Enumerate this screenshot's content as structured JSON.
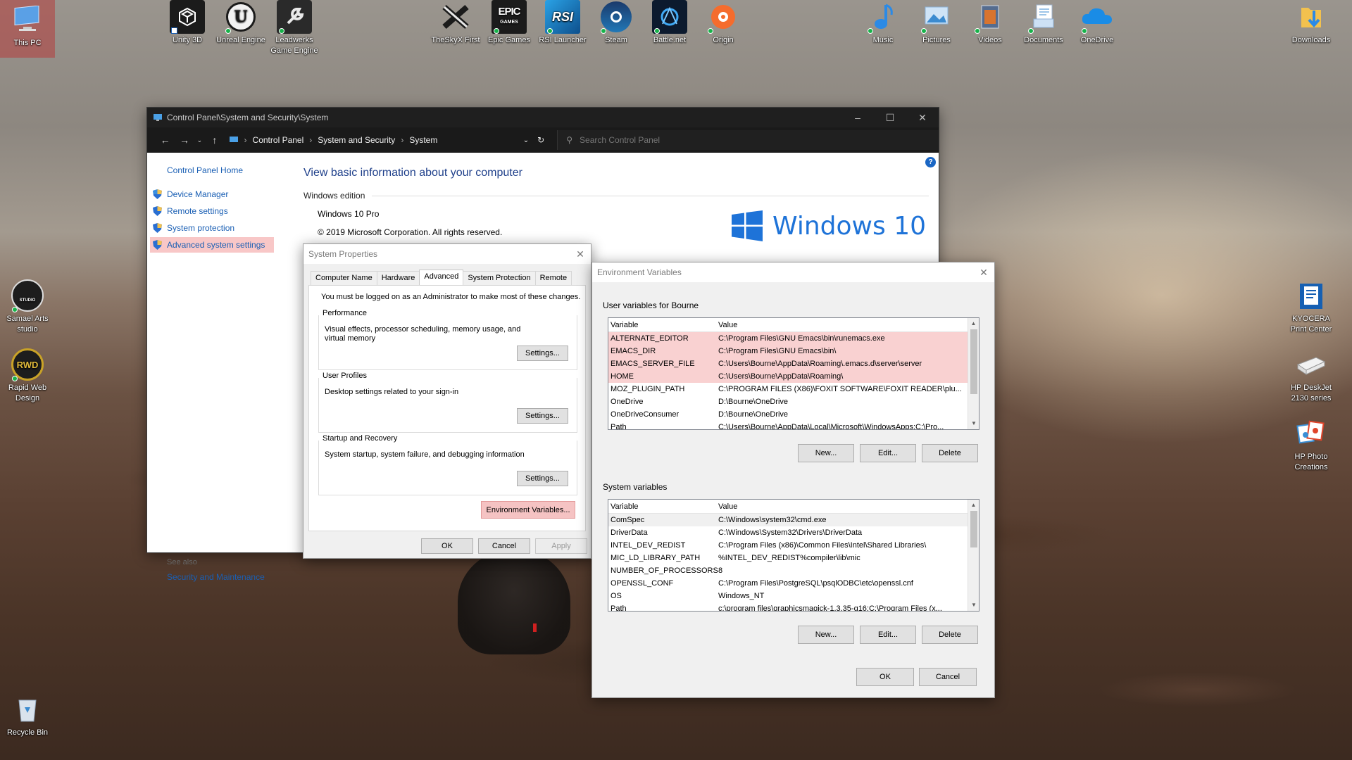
{
  "desktop": {
    "icons": [
      {
        "label": "This PC"
      },
      {
        "label": "Unity 3D"
      },
      {
        "label": "Unreal Engine"
      },
      {
        "label": "Leadwerks Game Engine"
      },
      {
        "label": "TheSkyX First"
      },
      {
        "label": "Epic Games"
      },
      {
        "label": "RSI Launcher"
      },
      {
        "label": "Steam"
      },
      {
        "label": "Battle.net"
      },
      {
        "label": "Origin"
      },
      {
        "label": "Music"
      },
      {
        "label": "Pictures"
      },
      {
        "label": "Videos"
      },
      {
        "label": "Documents"
      },
      {
        "label": "OneDrive"
      },
      {
        "label": "Downloads"
      },
      {
        "label": "Samael Arts studio"
      },
      {
        "label": "Rapid Web Design"
      },
      {
        "label": "KYOCERA Print Center"
      },
      {
        "label": "HP DeskJet 2130 series"
      },
      {
        "label": "HP Photo Creations"
      },
      {
        "label": "Recycle Bin"
      }
    ],
    "icon_glyphs": {
      "epic": "EPIC",
      "epic_sub": "GAMES",
      "rsi": "RSI",
      "rwd": "RWD",
      "studio": "STUDIO"
    }
  },
  "control_panel": {
    "title": "Control Panel\\System and Security\\System",
    "breadcrumb": [
      "Control Panel",
      "System and Security",
      "System"
    ],
    "search_placeholder": "Search Control Panel",
    "sidebar": {
      "home": "Control Panel Home",
      "items": [
        {
          "label": "Device Manager"
        },
        {
          "label": "Remote settings"
        },
        {
          "label": "System protection"
        },
        {
          "label": "Advanced system settings"
        }
      ],
      "see_also": "See also",
      "security_maintenance": "Security and Maintenance"
    },
    "heading": "View basic information about your computer",
    "windows_edition_label": "Windows edition",
    "edition": "Windows 10 Pro",
    "copyright": "© 2019 Microsoft Corporation. All rights reserved.",
    "logo_text": "Windows 10",
    "help": "?"
  },
  "system_properties": {
    "title": "System Properties",
    "tabs": [
      "Computer Name",
      "Hardware",
      "Advanced",
      "System Protection",
      "Remote"
    ],
    "active_tab": "Advanced",
    "admin_note": "You must be logged on as an Administrator to make most of these changes.",
    "performance": {
      "title": "Performance",
      "desc": "Visual effects, processor scheduling, memory usage, and virtual memory",
      "button": "Settings..."
    },
    "user_profiles": {
      "title": "User Profiles",
      "desc": "Desktop settings related to your sign-in",
      "button": "Settings..."
    },
    "startup_recovery": {
      "title": "Startup and Recovery",
      "desc": "System startup, system failure, and debugging information",
      "button": "Settings..."
    },
    "env_button": "Environment Variables...",
    "ok": "OK",
    "cancel": "Cancel",
    "apply": "Apply"
  },
  "environment_variables": {
    "title": "Environment Variables",
    "user_label": "User variables for Bourne",
    "columns": [
      "Variable",
      "Value"
    ],
    "user_vars": [
      {
        "name": "ALTERNATE_EDITOR",
        "value": "C:\\Program Files\\GNU Emacs\\bin\\runemacs.exe",
        "highlight": true
      },
      {
        "name": "EMACS_DIR",
        "value": "C:\\Program Files\\GNU Emacs\\bin\\",
        "highlight": true
      },
      {
        "name": "EMACS_SERVER_FILE",
        "value": "C:\\Users\\Bourne\\AppData\\Roaming\\.emacs.d\\server\\server",
        "highlight": true
      },
      {
        "name": "HOME",
        "value": "C:\\Users\\Bourne\\AppData\\Roaming\\",
        "highlight": true
      },
      {
        "name": "MOZ_PLUGIN_PATH",
        "value": "C:\\PROGRAM FILES (X86)\\FOXIT SOFTWARE\\FOXIT READER\\plu...",
        "highlight": false
      },
      {
        "name": "OneDrive",
        "value": "D:\\Bourne\\OneDrive",
        "highlight": false
      },
      {
        "name": "OneDriveConsumer",
        "value": "D:\\Bourne\\OneDrive",
        "highlight": false
      },
      {
        "name": "Path",
        "value": "C:\\Users\\Bourne\\AppData\\Local\\Microsoft\\WindowsApps;C:\\Pro...",
        "highlight": false
      }
    ],
    "system_label": "System variables",
    "system_vars": [
      {
        "name": "ComSpec",
        "value": "C:\\Windows\\system32\\cmd.exe"
      },
      {
        "name": "DriverData",
        "value": "C:\\Windows\\System32\\Drivers\\DriverData"
      },
      {
        "name": "INTEL_DEV_REDIST",
        "value": "C:\\Program Files (x86)\\Common Files\\Intel\\Shared Libraries\\"
      },
      {
        "name": "MIC_LD_LIBRARY_PATH",
        "value": "%INTEL_DEV_REDIST%compiler\\lib\\mic"
      },
      {
        "name": "NUMBER_OF_PROCESSORS",
        "value": "8"
      },
      {
        "name": "OPENSSL_CONF",
        "value": "C:\\Program Files\\PostgreSQL\\psqlODBC\\etc\\openssl.cnf"
      },
      {
        "name": "OS",
        "value": "Windows_NT"
      },
      {
        "name": "Path",
        "value": "c:\\program files\\graphicsmagick-1.3.35-q16;C:\\Program Files (x..."
      }
    ],
    "new_button": "New...",
    "edit_button": "Edit...",
    "delete_button": "Delete",
    "ok": "OK",
    "cancel": "Cancel"
  },
  "colors": {
    "accent": "#1a5fb4",
    "highlight_pink": "#f9d1d1",
    "windows_blue": "#1e73d8"
  }
}
